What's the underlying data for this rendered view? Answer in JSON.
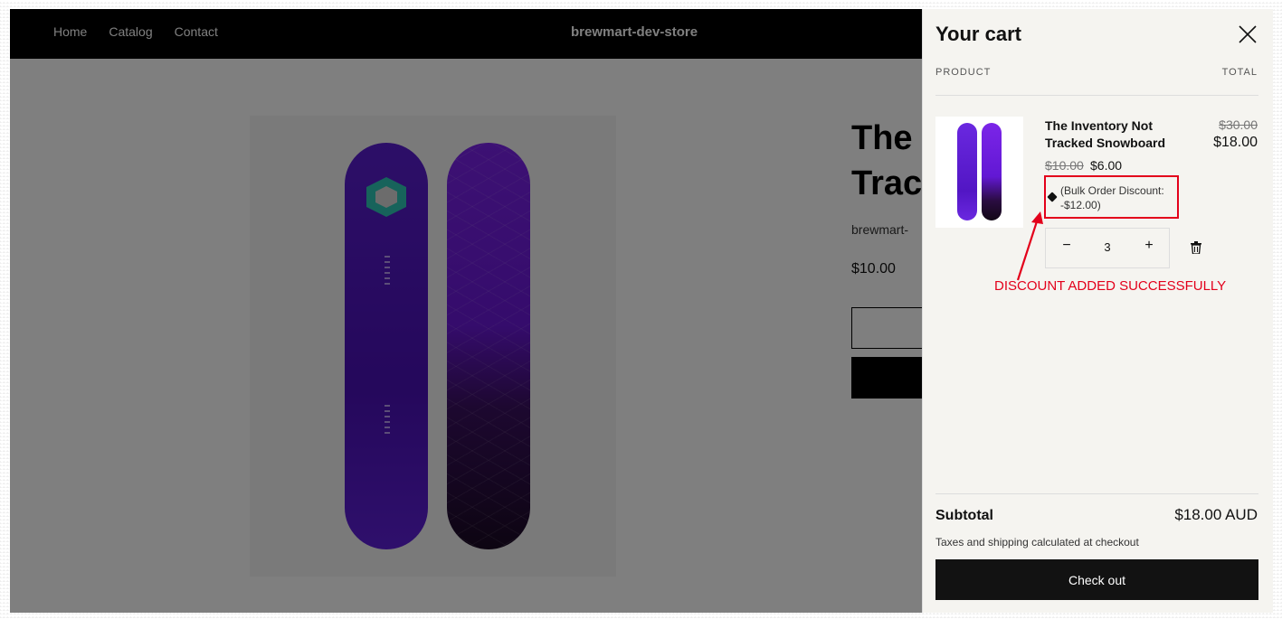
{
  "header": {
    "nav": [
      "Home",
      "Catalog",
      "Contact"
    ],
    "brand": "brewmart-dev-store"
  },
  "product_page": {
    "title_partial": "The\nTrac",
    "vendor_partial": "brewmart-",
    "price": "$10.00"
  },
  "cart": {
    "title": "Your cart",
    "column_product": "PRODUCT",
    "column_total": "TOTAL",
    "item": {
      "name": "The Inventory Not Tracked Snowboard",
      "line_original_price": "$30.00",
      "line_final_price": "$18.00",
      "unit_original_price": "$10.00",
      "unit_final_price": "$6.00",
      "discount": "(Bulk Order Discount: -$12.00)",
      "quantity": "3",
      "minus": "−",
      "plus": "+"
    },
    "annotation": "DISCOUNT ADDED SUCCESSFULLY",
    "subtotal_label": "Subtotal",
    "subtotal_value": "$18.00 AUD",
    "tax_note": "Taxes and shipping calculated at checkout",
    "checkout_label": "Check out"
  },
  "icons": [
    "close-icon",
    "discount-tag-icon",
    "trash-icon",
    "arrow-annotation-icon"
  ],
  "colors": {
    "highlight": "#e3001b",
    "drawer_bg": "#f5f4f0",
    "button": "#121212"
  }
}
